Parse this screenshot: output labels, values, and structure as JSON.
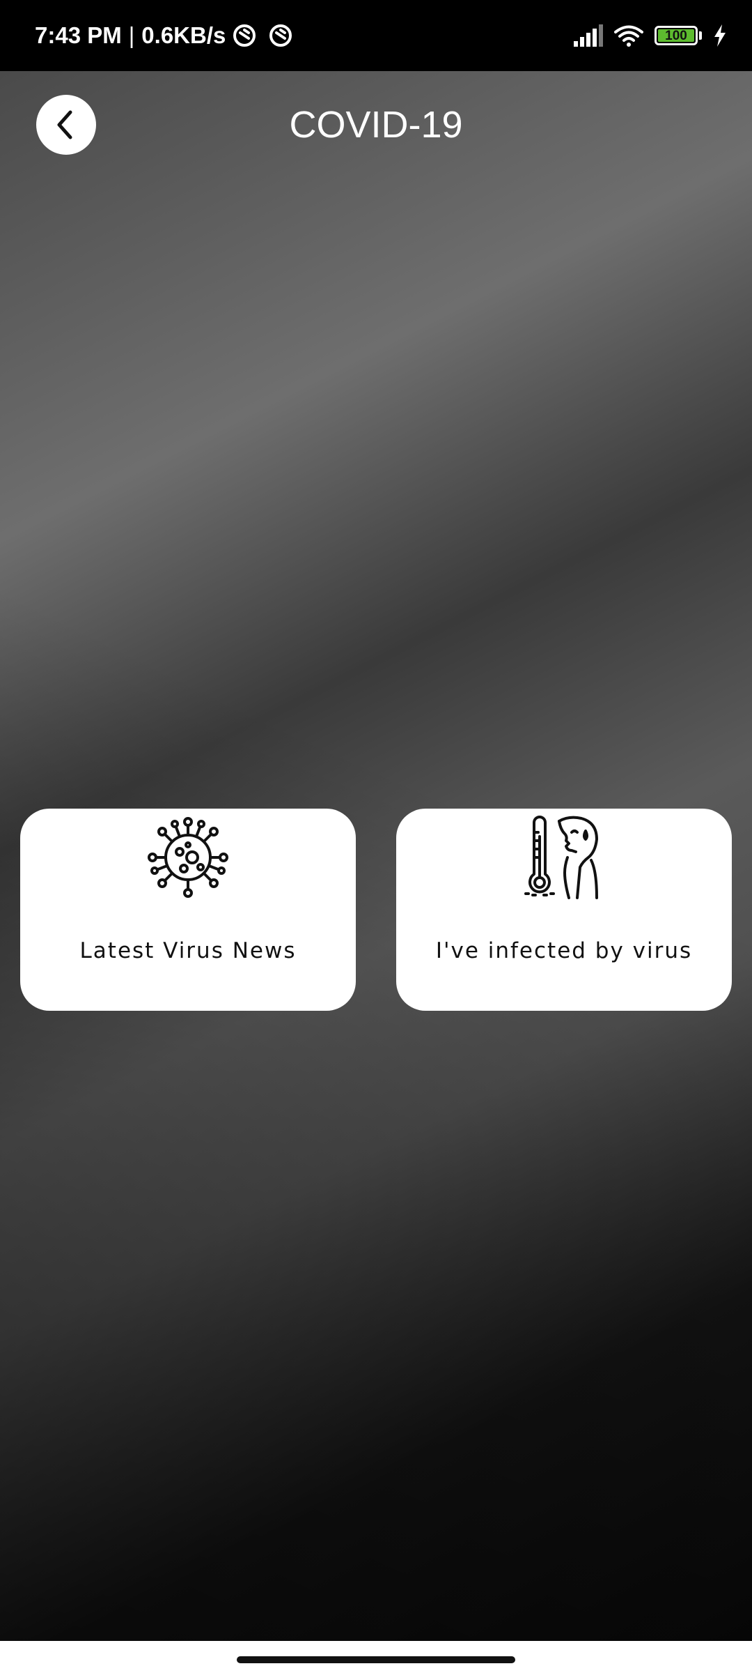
{
  "status_bar": {
    "time": "7:43 PM",
    "separator": "|",
    "network_speed": "0.6KB/s",
    "battery_level": "100",
    "icons": [
      "sync-icon",
      "sync-icon",
      "signal-icon",
      "wifi-icon",
      "battery-icon",
      "charging-icon"
    ],
    "battery_color": "#5dbb2f"
  },
  "header": {
    "title": "COVID-19",
    "back_icon": "chevron-left-icon"
  },
  "cards": [
    {
      "label": "Latest Virus News",
      "icon": "virus-icon"
    },
    {
      "label": "I've infected by virus",
      "icon": "fever-icon"
    }
  ],
  "colors": {
    "card_background": "#ffffff",
    "title_color": "#ffffff"
  }
}
